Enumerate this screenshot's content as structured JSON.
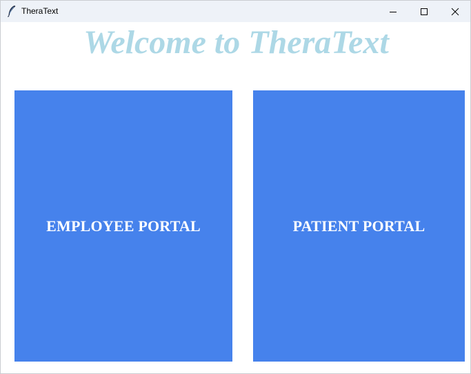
{
  "window": {
    "title": "TheraText",
    "icon": "feather-icon",
    "controls": {
      "minimize": "minimize-icon",
      "maximize": "maximize-icon",
      "close": "close-icon"
    }
  },
  "main": {
    "heading": "Welcome to TheraText",
    "heading_color": "#add8e6",
    "portals": {
      "employee": {
        "label": "EMPLOYEE PORTAL"
      },
      "patient": {
        "label": "PATIENT PORTAL"
      }
    },
    "portal_color": "#4682ec"
  }
}
